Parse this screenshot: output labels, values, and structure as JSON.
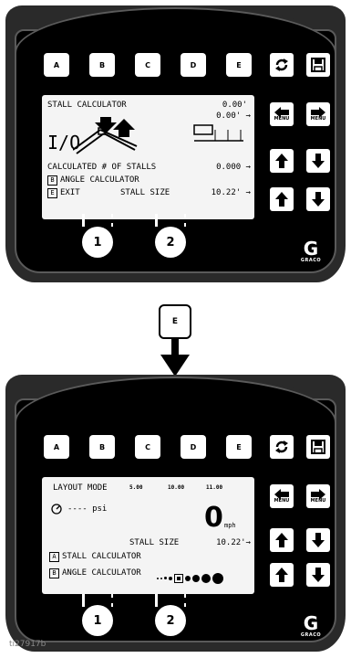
{
  "softkeys": [
    "A",
    "B",
    "C",
    "D",
    "E"
  ],
  "side_keys": {
    "menu_label": "MENU"
  },
  "screen1": {
    "title": "STALL CALCULATOR",
    "value1": "0.00'",
    "value2": "0.00' →",
    "io": "I/O",
    "calculated": "CALCULATED # OF STALLS",
    "calculated_value": "0.000 →",
    "opt_b_key": "B",
    "opt_b_label": "ANGLE CALCULATOR",
    "opt_e_key": "E",
    "opt_e_label": "EXIT",
    "stall_size_label": "STALL SIZE",
    "stall_size_value": "10.22' →"
  },
  "screen2": {
    "mode": "LAYOUT MODE",
    "col1": "5.00",
    "col2": "10.00",
    "col3": "11.00",
    "psi": "---- psi",
    "speed": "0",
    "speed_unit": "mph",
    "stall_size_label": "STALL SIZE",
    "stall_size_value": "10.22'→",
    "opt_a_key": "A",
    "opt_a_label": "STALL CALCULATOR",
    "opt_b_key": "B",
    "opt_b_label": "ANGLE CALCULATOR"
  },
  "knobs": [
    "1",
    "2"
  ],
  "logo": "GRACO",
  "transition_key": "E",
  "watermark": "ti27917b"
}
